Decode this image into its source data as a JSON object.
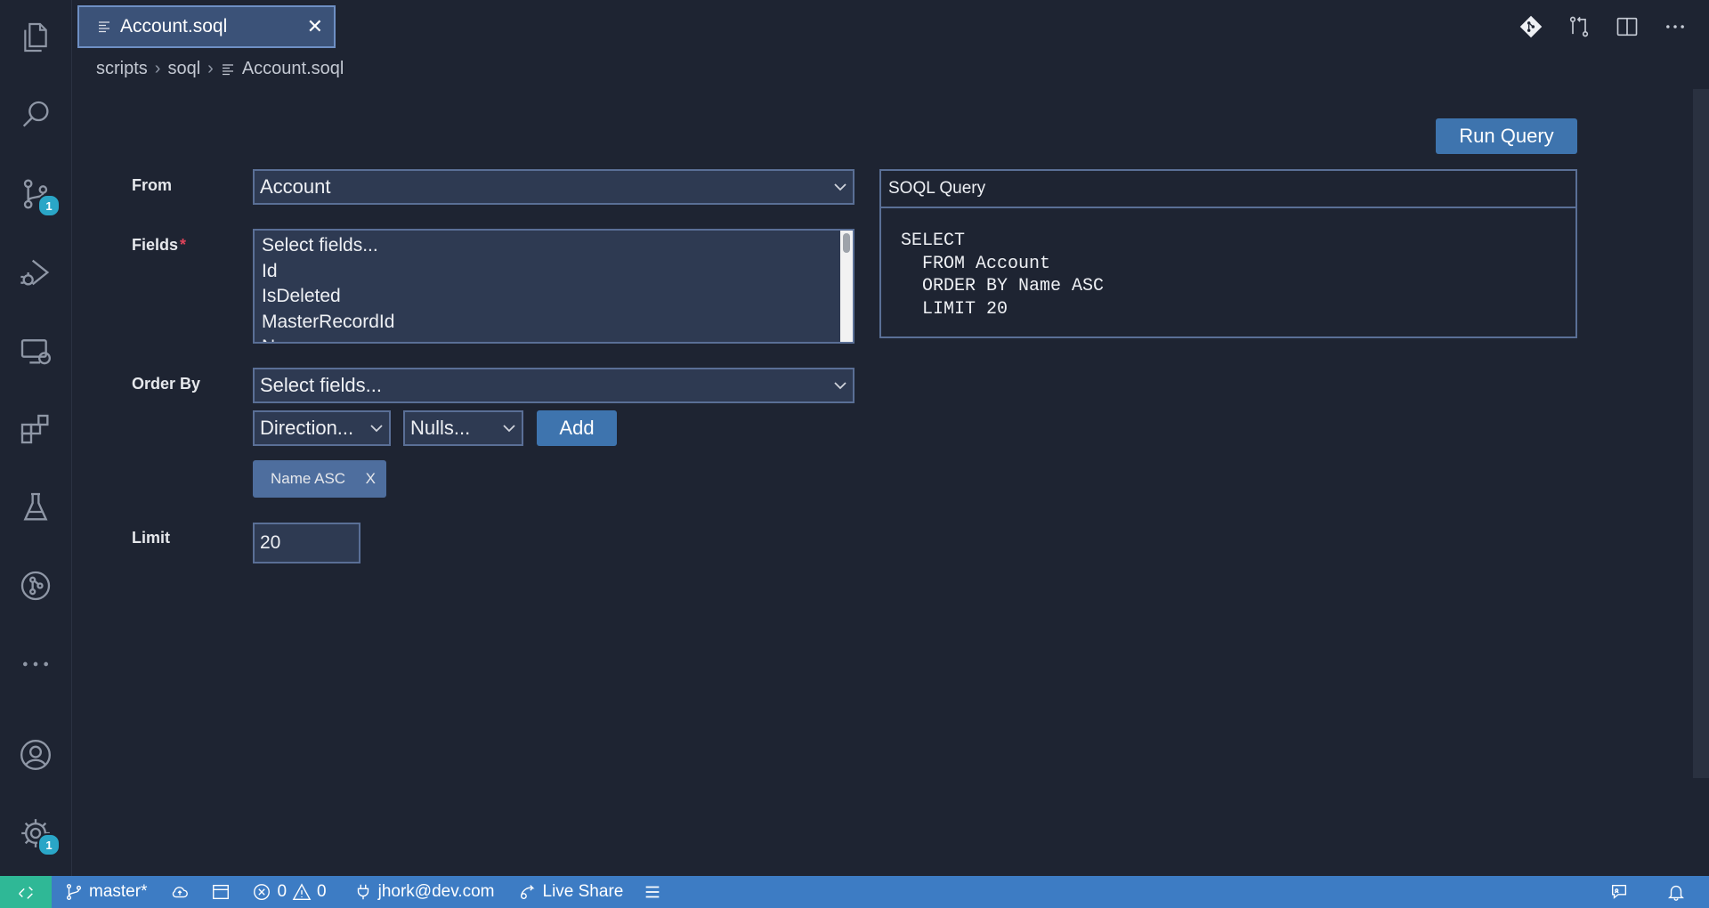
{
  "tab": {
    "title": "Account.soql",
    "close": "X"
  },
  "breadcrumb": [
    "scripts",
    "soql",
    "Account.soql"
  ],
  "activity": {
    "source_control_badge": "1",
    "settings_badge": "1"
  },
  "form": {
    "from_label": "From",
    "from_value": "Account",
    "fields_label": "Fields",
    "fields_required": "*",
    "fields_options": [
      "Select fields...",
      "Id",
      "IsDeleted",
      "MasterRecordId",
      "N..."
    ],
    "order_by_label": "Order By",
    "order_by_value": "Select fields...",
    "direction_value": "Direction...",
    "nulls_value": "Nulls...",
    "add_label": "Add",
    "order_pill": "Name ASC",
    "order_pill_remove": "X",
    "limit_label": "Limit",
    "limit_value": "20",
    "run_query_label": "Run Query"
  },
  "query": {
    "header": "SOQL Query",
    "lines": [
      "SELECT",
      "  FROM Account",
      "  ORDER BY Name ASC",
      "  LIMIT 20"
    ]
  },
  "status": {
    "branch": "master*",
    "errors": "0",
    "warnings": "0",
    "user": "jhork@dev.com",
    "live_share": "Live Share"
  },
  "colors": {
    "accent": "#3e74ae",
    "status_bar": "#3d7cc4",
    "badge": "#2aa6c7",
    "remote": "#2fb896"
  }
}
